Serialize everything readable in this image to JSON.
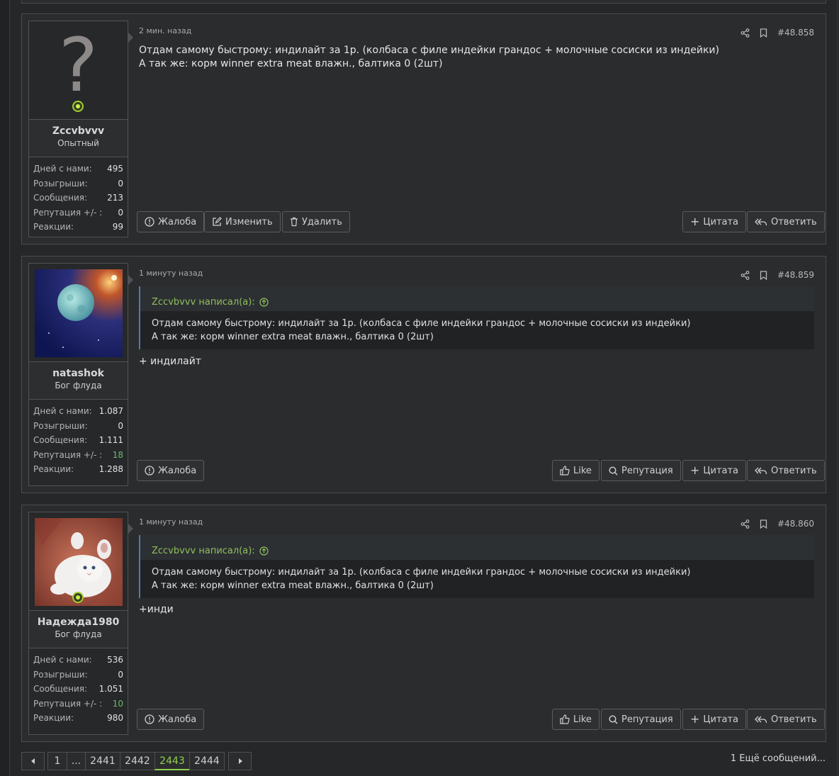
{
  "posts": [
    {
      "user": {
        "name": "Zccvbvvv",
        "title": "Опытный",
        "avatar": "question-mark",
        "online": true,
        "stats": [
          {
            "label": "Дней с нами:",
            "value": "495"
          },
          {
            "label": "Розыгрыши:",
            "value": "0"
          },
          {
            "label": "Сообщения:",
            "value": "213"
          },
          {
            "label": "Репутация +/- :",
            "value": "0"
          },
          {
            "label": "Реакции:",
            "value": "99"
          }
        ]
      },
      "time": "2 мин. назад",
      "number": "#48.858",
      "body_line1": "Отдам самому быстрому: индилайт за 1р. (колбаса с филе индейки грандос + молочные сосиски из индейки)",
      "body_line2": "А так же: корм winner extra meat влажн., балтика 0 (2шт)",
      "buttons": {
        "report": "Жалоба",
        "edit": "Изменить",
        "delete": "Удалить",
        "quote": "Цитата",
        "reply": "Ответить"
      }
    },
    {
      "user": {
        "name": "natashok",
        "title": "Бог флуда",
        "avatar": "moon-image",
        "online": false,
        "stats": [
          {
            "label": "Дней с нами:",
            "value": "1.087"
          },
          {
            "label": "Розыгрыши:",
            "value": "0"
          },
          {
            "label": "Сообщения:",
            "value": "1.111"
          },
          {
            "label": "Репутация +/- :",
            "value": "18"
          },
          {
            "label": "Реакции:",
            "value": "1.288"
          }
        ]
      },
      "time": "1 минуту назад",
      "number": "#48.859",
      "quote": {
        "author": "Zccvbvvv написал(а):",
        "line1": "Отдам самому быстрому: индилайт за 1р. (колбаса с филе индейки грандос + молочные сосиски из индейки)",
        "line2": "А так же: корм winner extra meat влажн., балтика 0 (2шт)"
      },
      "reply": "+ индилайт",
      "buttons": {
        "report": "Жалоба",
        "like": "Like",
        "reputation": "Репутация",
        "quote": "Цитата",
        "reply": "Ответить"
      }
    },
    {
      "user": {
        "name": "Надежда1980",
        "title": "Бог флуда",
        "avatar": "kitten-image",
        "online": true,
        "stats": [
          {
            "label": "Дней с нами:",
            "value": "536"
          },
          {
            "label": "Розыгрыши:",
            "value": "0"
          },
          {
            "label": "Сообщения:",
            "value": "1.051"
          },
          {
            "label": "Репутация +/- :",
            "value": "10"
          },
          {
            "label": "Реакции:",
            "value": "980"
          }
        ]
      },
      "time": "1 минуту назад",
      "number": "#48.860",
      "quote": {
        "author": "Zccvbvvv написал(а):",
        "line1": "Отдам самому быстрому: индилайт за 1р. (колбаса с филе индейки грандос + молочные сосиски из индейки)",
        "line2": "А так же: корм winner extra meat влажн., балтика 0 (2шт)"
      },
      "reply": "+инди",
      "buttons": {
        "report": "Жалоба",
        "like": "Like",
        "reputation": "Репутация",
        "quote": "Цитата",
        "reply": "Ответить"
      }
    }
  ],
  "pagination": {
    "pages": [
      "1",
      "...",
      "2441",
      "2442",
      "2443",
      "2444"
    ],
    "current": "2443",
    "more_text": "1 Ещё сообщений..."
  },
  "colors": {
    "accent_green": "#8fd14f",
    "quote_border": "#4f7bb0",
    "reputation_positive": "#6fb86f"
  }
}
